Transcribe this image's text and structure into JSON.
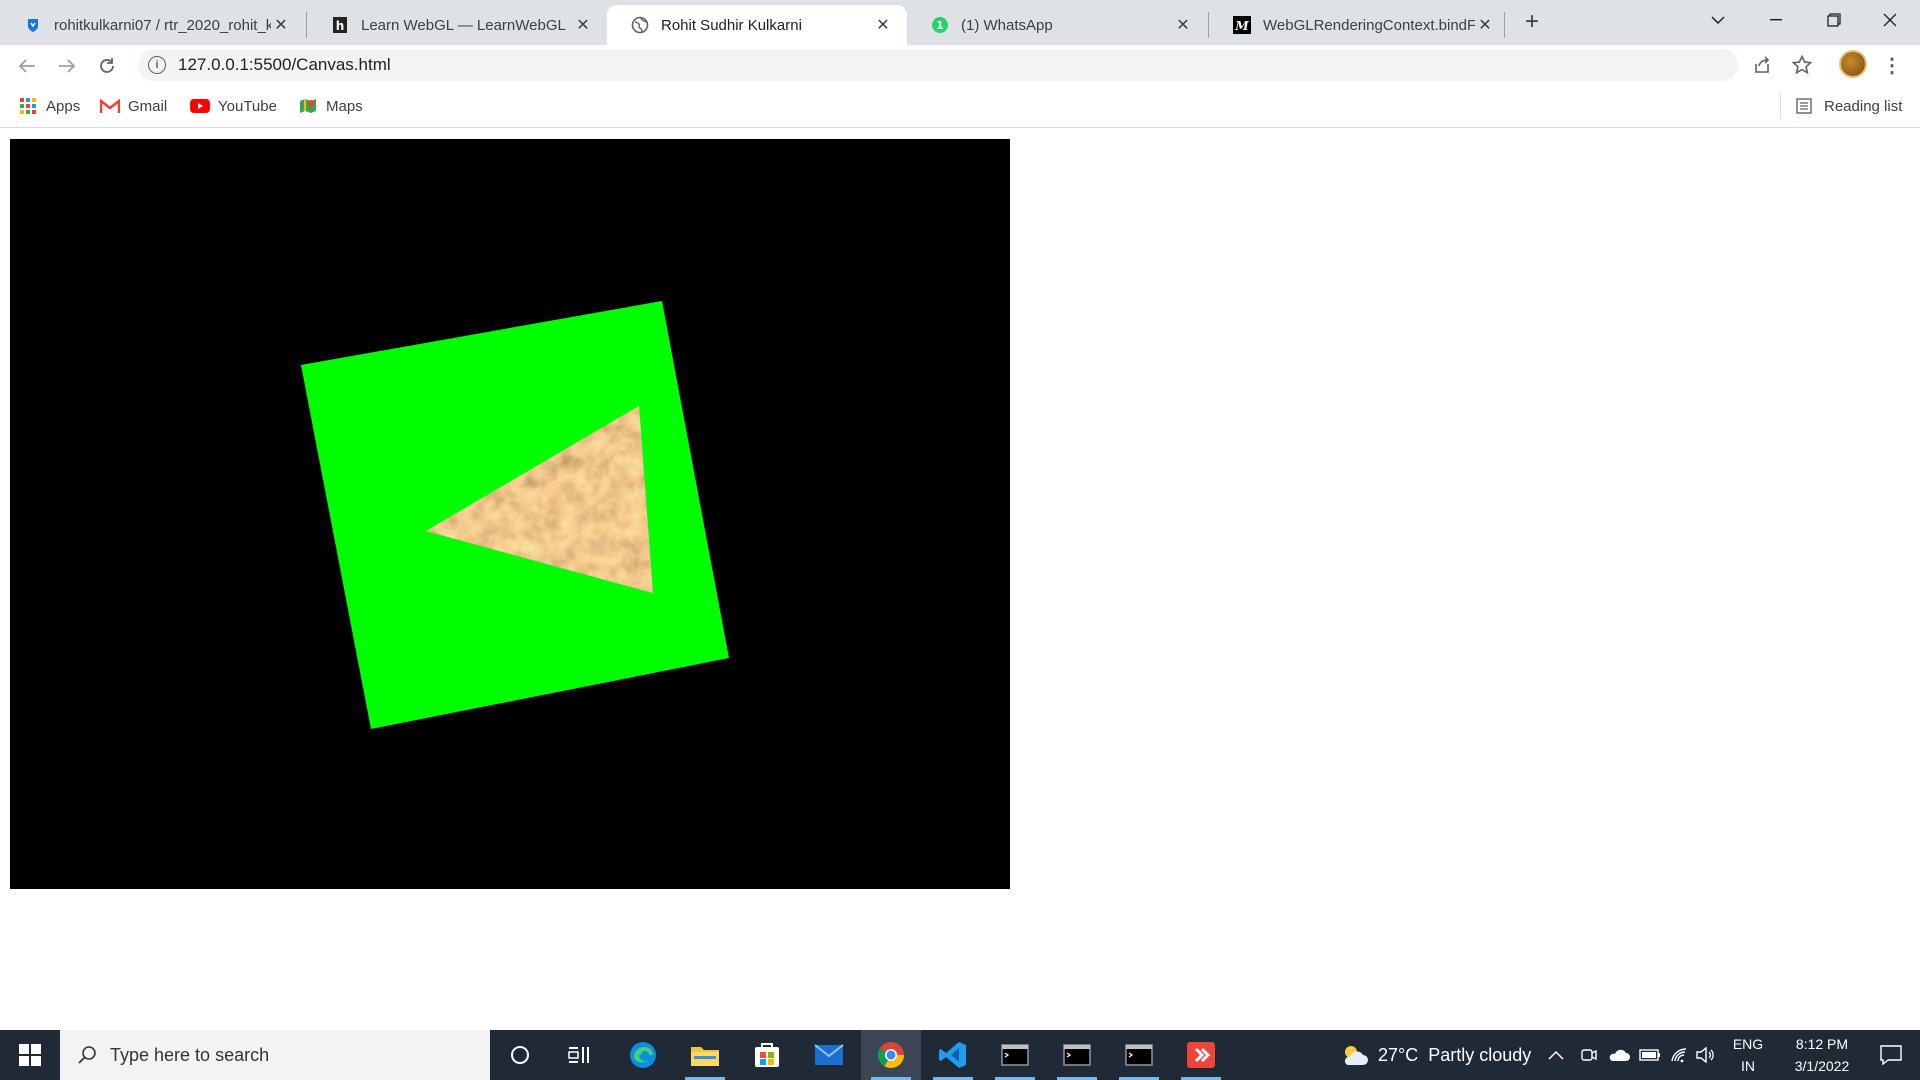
{
  "browser": {
    "tabs": [
      {
        "title": "rohitkulkarni07 / rtr_2020_rohit_k",
        "favicon": "shield-icon",
        "active": false
      },
      {
        "title": "Learn WebGL — LearnWebGL",
        "favicon": "learnwebgl-icon",
        "active": false
      },
      {
        "title": "Rohit Sudhir Kulkarni",
        "favicon": "globe-icon",
        "active": true
      },
      {
        "title": "(1) WhatsApp",
        "favicon": "whatsapp-icon",
        "active": false
      },
      {
        "title": "WebGLRenderingContext.bindFra",
        "favicon": "mdn-icon",
        "active": false
      }
    ],
    "address": "127.0.0.1:5500/Canvas.html",
    "bookmarks": [
      {
        "label": "Apps",
        "icon": "apps-grid-icon"
      },
      {
        "label": "Gmail",
        "icon": "gmail-icon"
      },
      {
        "label": "YouTube",
        "icon": "youtube-icon"
      },
      {
        "label": "Maps",
        "icon": "maps-icon"
      }
    ],
    "reading_list": "Reading list"
  },
  "canvas": {
    "background": "#000000",
    "square_color": "#00ff00",
    "triangle_texture": "marble-texture"
  },
  "taskbar": {
    "search_placeholder": "Type here to search",
    "weather": "27°C  Partly cloudy",
    "lang_top": "ENG",
    "lang_bottom": "IN",
    "time": "8:12 PM",
    "date": "3/1/2022"
  }
}
